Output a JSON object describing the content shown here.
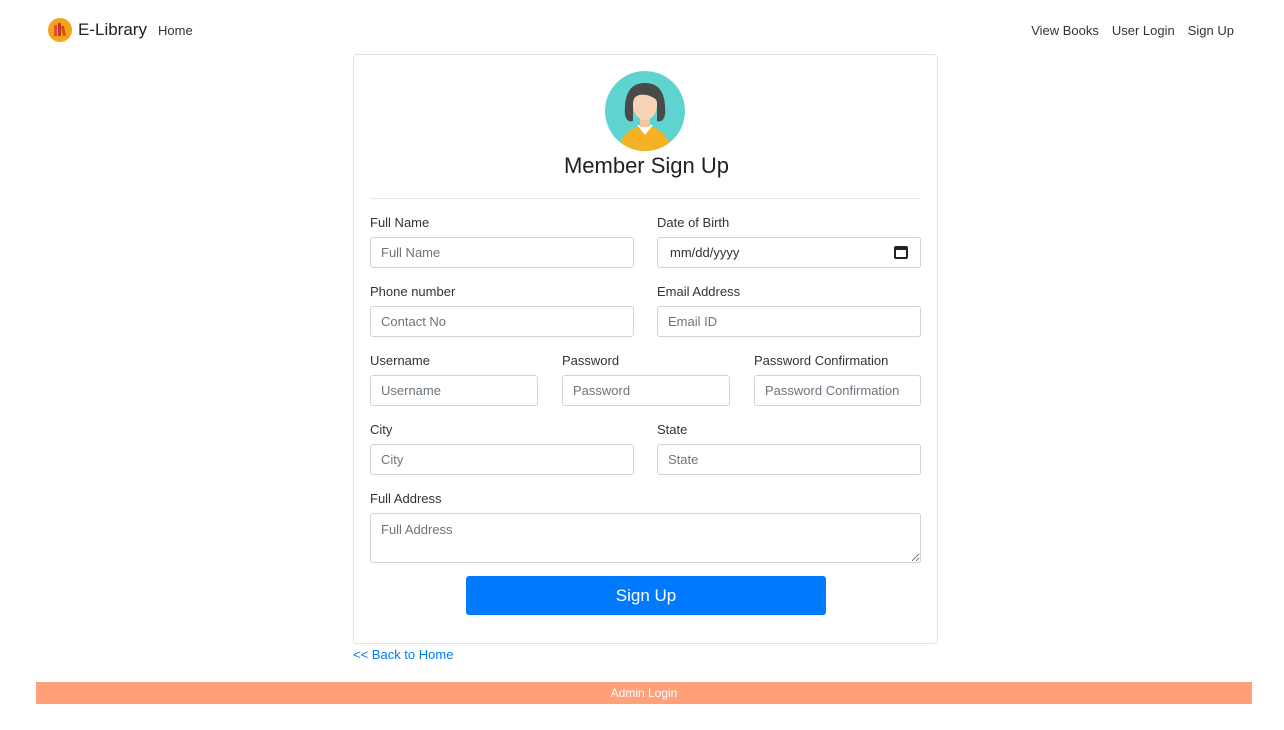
{
  "navbar": {
    "brand": "E-Library",
    "home": "Home",
    "right_links": [
      "View Books",
      "User Login",
      "Sign Up"
    ]
  },
  "form": {
    "title": "Member Sign Up",
    "full_name": {
      "label": "Full Name",
      "placeholder": "Full Name"
    },
    "dob": {
      "label": "Date of Birth",
      "value": "mm/dd/yyyy"
    },
    "phone": {
      "label": "Phone number",
      "placeholder": "Contact No"
    },
    "email": {
      "label": "Email Address",
      "placeholder": "Email ID"
    },
    "username": {
      "label": "Username",
      "placeholder": "Username"
    },
    "password": {
      "label": "Password",
      "placeholder": "Password"
    },
    "password_confirm": {
      "label": "Password Confirmation",
      "placeholder": "Password Confirmation"
    },
    "city": {
      "label": "City",
      "placeholder": "City"
    },
    "state": {
      "label": "State",
      "placeholder": "State"
    },
    "address": {
      "label": "Full Address",
      "placeholder": "Full Address"
    },
    "submit": "Sign Up"
  },
  "back_link": "<< Back to Home",
  "footer": {
    "admin_login": "Admin Login"
  },
  "icons": {
    "logo": "books-logo-icon",
    "avatar": "user-avatar-icon",
    "calendar": "calendar-icon"
  },
  "colors": {
    "primary": "#007bff",
    "footer": "#ffa07a",
    "avatar_bg": "#5fd3cf",
    "avatar_shirt": "#f5b324"
  }
}
